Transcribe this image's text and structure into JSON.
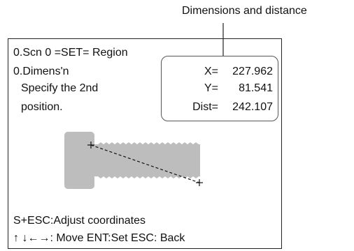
{
  "callout": {
    "label": "Dimensions and distance"
  },
  "screen": {
    "title_line": "0.Scn 0 =SET= Region",
    "mode_line": "0.Dimens'n",
    "instruction_line1": "Specify the 2nd",
    "instruction_line2": "position."
  },
  "readout": {
    "x_label": "X=",
    "x_value": "227.962",
    "y_label": "Y=",
    "y_value": "81.541",
    "dist_label": "Dist=",
    "dist_value": "242.107"
  },
  "footer": {
    "line1": "S+ESC:Adjust coordinates",
    "arrows": "↑ ↓←→",
    "line2_rest": ": Move ENT:Set ESC: Back"
  },
  "colors": {
    "part_fill": "#bdbdbd",
    "frame": "#222222"
  },
  "icons": {
    "cursor_markers": "plus-marker"
  }
}
